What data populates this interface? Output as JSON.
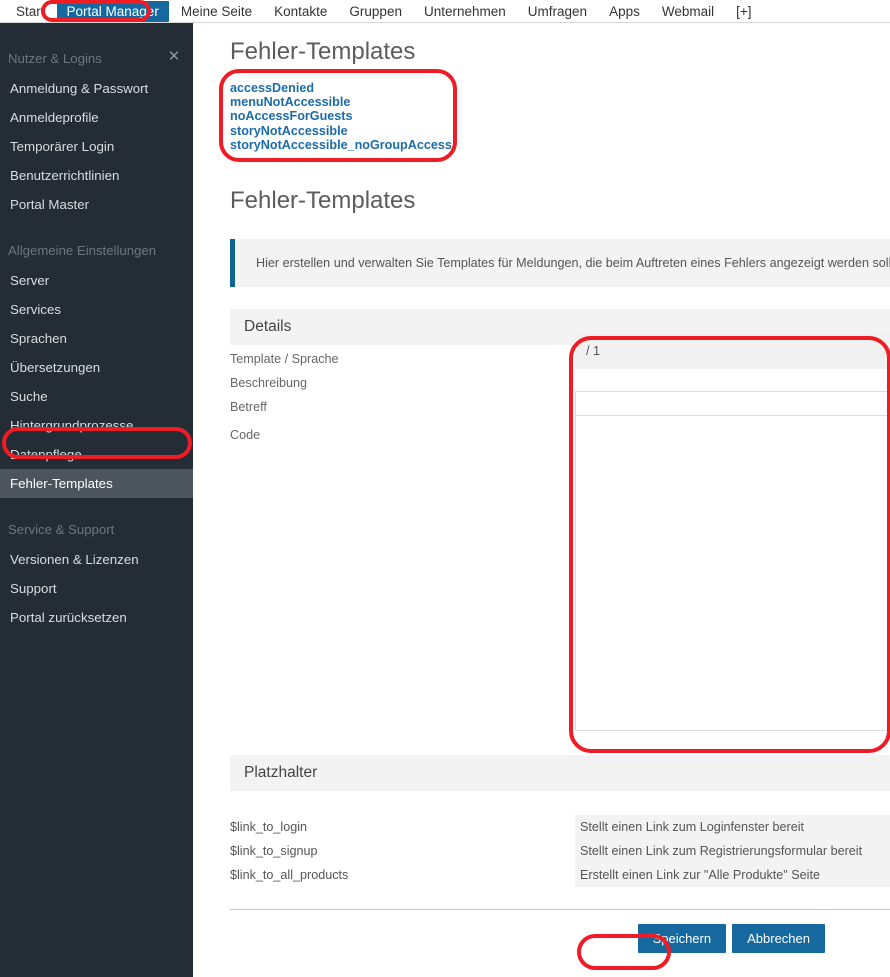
{
  "topnav": {
    "items": [
      {
        "label": "Start",
        "active": false
      },
      {
        "label": "Portal Manager",
        "active": true
      },
      {
        "label": "Meine Seite",
        "active": false
      },
      {
        "label": "Kontakte",
        "active": false
      },
      {
        "label": "Gruppen",
        "active": false
      },
      {
        "label": "Unternehmen",
        "active": false
      },
      {
        "label": "Umfragen",
        "active": false
      },
      {
        "label": "Apps",
        "active": false
      },
      {
        "label": "Webmail",
        "active": false
      },
      {
        "label": "[+]",
        "active": false
      }
    ],
    "active_color": "#16699e"
  },
  "sidebar": {
    "close_label": "✕",
    "background": "#242c35",
    "active_background": "#4c545e",
    "groups": [
      {
        "title": "Nutzer & Logins",
        "items": [
          {
            "label": "Anmeldung & Passwort",
            "active": false
          },
          {
            "label": "Anmeldeprofile",
            "active": false
          },
          {
            "label": "Temporärer Login",
            "active": false
          },
          {
            "label": "Benutzerrichtlinien",
            "active": false
          },
          {
            "label": "Portal Master",
            "active": false
          }
        ]
      },
      {
        "title": "Allgemeine Einstellungen",
        "items": [
          {
            "label": "Server",
            "active": false
          },
          {
            "label": "Services",
            "active": false
          },
          {
            "label": "Sprachen",
            "active": false
          },
          {
            "label": "Übersetzungen",
            "active": false
          },
          {
            "label": "Suche",
            "active": false
          },
          {
            "label": "Hintergrundprozesse",
            "active": false
          },
          {
            "label": "Datenpflege",
            "active": false
          },
          {
            "label": "Fehler-Templates",
            "active": true
          }
        ]
      },
      {
        "title": "Service & Support",
        "items": [
          {
            "label": "Versionen & Lizenzen",
            "active": false
          },
          {
            "label": "Support",
            "active": false
          },
          {
            "label": "Portal zurücksetzen",
            "active": false
          }
        ]
      }
    ]
  },
  "main": {
    "page_title": "Fehler-Templates",
    "template_links": [
      "accessDenied",
      "menuNotAccessible",
      "noAccessForGuests",
      "storyNotAccessible",
      "storyNotAccessible_noGroupAccess"
    ],
    "link_color": "#1b6ca8",
    "section_title": "Fehler-Templates",
    "info_text": "Hier erstellen und verwalten Sie Templates für Meldungen, die beim Auftreten eines Fehlers angezeigt werden sollen,",
    "info_border_color": "#0f6694",
    "details_band": "Details",
    "form": {
      "rows": [
        {
          "label": "Template / Sprache",
          "value": "/ 1",
          "type": "select"
        },
        {
          "label": "Beschreibung",
          "value": "",
          "type": "text"
        },
        {
          "label": "Betreff",
          "value": "",
          "type": "text"
        },
        {
          "label": "Code",
          "value": "",
          "type": "textarea"
        }
      ]
    },
    "placeholder_band": "Platzhalter",
    "placeholders": [
      {
        "key": "$link_to_login",
        "desc": "Stellt einen Link zum Loginfenster bereit"
      },
      {
        "key": "$link_to_signup",
        "desc": "Stellt einen Link zum Registrierungsformular bereit"
      },
      {
        "key": "$link_to_all_products",
        "desc": "Erstellt einen Link zur \"Alle Produkte\" Seite"
      }
    ],
    "buttons": {
      "save": "Speichern",
      "cancel": "Abbrechen",
      "color": "#16699e"
    }
  },
  "annotations": {
    "color": "#ee1c25",
    "targets": [
      "portal-manager-tab",
      "template-link-list",
      "sidebar-item-fehler-templates",
      "details-form-column",
      "save-button"
    ]
  }
}
